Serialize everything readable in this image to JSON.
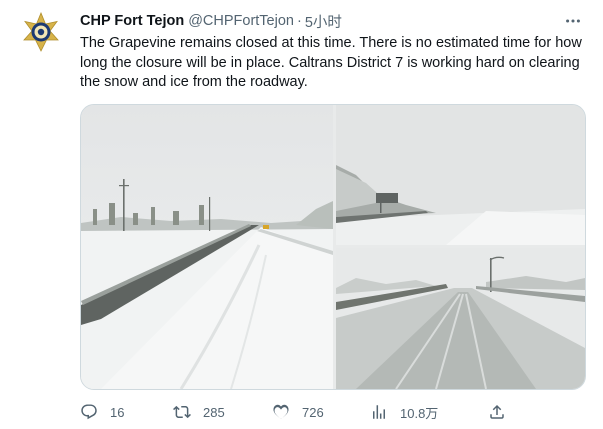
{
  "tweet": {
    "author_name": "CHP Fort Tejon",
    "author_handle": "@CHPFortTejon",
    "separator": "·",
    "time": "5小时",
    "text": "The Grapevine remains closed at this time.  There is no estimated time for how long the closure will be in place.  Caltrans District 7 is working hard on clearing the snow and ice from the roadway."
  },
  "avatar": {
    "icon": "chp-badge-icon",
    "colors": {
      "badge": "#1d3a73",
      "star": "#d7b34a"
    }
  },
  "media": {
    "photos": [
      {
        "name": "snowy-highway-wide-photo"
      },
      {
        "name": "snowy-highway-fog-photo"
      },
      {
        "name": "icy-roadway-photo"
      }
    ]
  },
  "actions": {
    "reply": {
      "icon": "reply-icon",
      "count": "16"
    },
    "retweet": {
      "icon": "retweet-icon",
      "count": "285"
    },
    "like": {
      "icon": "heart-icon",
      "count": "726"
    },
    "views": {
      "icon": "views-icon",
      "count": "10.8万"
    },
    "share": {
      "icon": "share-icon"
    }
  },
  "colors": {
    "text": "#0f1419",
    "secondary": "#536471",
    "border": "#cfd9de"
  }
}
